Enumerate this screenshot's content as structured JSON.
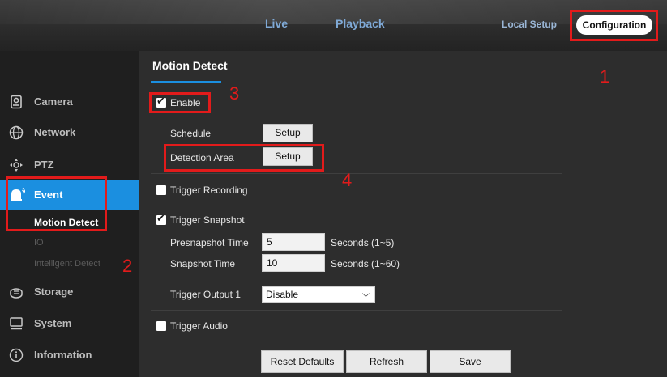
{
  "header": {
    "nav_live": "Live",
    "nav_playback": "Playback",
    "nav_local_setup": "Local Setup",
    "nav_configuration": "Configuration"
  },
  "sidebar": {
    "items": [
      {
        "label": "Camera",
        "icon": "camera-icon"
      },
      {
        "label": "Network",
        "icon": "network-globe-icon"
      },
      {
        "label": "PTZ",
        "icon": "ptz-icon"
      },
      {
        "label": "Event",
        "icon": "event-bell-icon"
      },
      {
        "label": "Storage",
        "icon": "storage-icon"
      },
      {
        "label": "System",
        "icon": "monitor-icon"
      },
      {
        "label": "Information",
        "icon": "info-icon"
      }
    ],
    "event_sub": [
      {
        "label": "Motion Detect"
      },
      {
        "label": "IO"
      },
      {
        "label": "Intelligent Detect"
      }
    ],
    "accent": "#1b8fe0"
  },
  "main": {
    "title": "Motion Detect",
    "enable_label": "Enable",
    "schedule_label": "Schedule",
    "schedule_button": "Setup",
    "detection_area_label": "Detection Area",
    "detection_area_button": "Setup",
    "trigger_recording": "Trigger Recording",
    "trigger_snapshot": "Trigger Snapshot",
    "presnapshot_label": "Presnapshot Time",
    "presnapshot_value": "5",
    "presnapshot_hint": "Seconds (1~5)",
    "snapshot_label": "Snapshot Time",
    "snapshot_value": "10",
    "snapshot_hint": "Seconds (1~60)",
    "trigger_output_label": "Trigger Output 1",
    "trigger_output_value": "Disable",
    "trigger_audio": "Trigger Audio",
    "checks": {
      "enable": true,
      "trigger_recording": false,
      "trigger_snapshot": true,
      "trigger_audio": false
    }
  },
  "footer": {
    "reset": "Reset Defaults",
    "refresh": "Refresh",
    "save": "Save"
  },
  "annotations": {
    "n1": "1",
    "n2": "2",
    "n3": "3",
    "n4": "4",
    "color": "#e21b1b"
  }
}
